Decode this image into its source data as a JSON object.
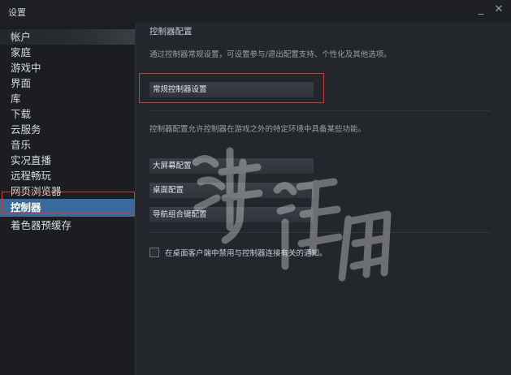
{
  "window": {
    "title": "设置",
    "minimize": "_",
    "close": "✕"
  },
  "sidebar": {
    "items": [
      {
        "label": "帐户"
      },
      {
        "label": "家庭"
      },
      {
        "label": "游戏中"
      },
      {
        "label": "界面"
      },
      {
        "label": "库"
      },
      {
        "label": "下载"
      },
      {
        "label": "云服务"
      },
      {
        "label": "音乐"
      },
      {
        "label": "实况直播"
      },
      {
        "label": "远程畅玩"
      },
      {
        "label": "网页浏览器"
      },
      {
        "label": "控制器"
      },
      {
        "label": "着色器预缓存"
      }
    ],
    "active_index": 11
  },
  "main": {
    "title": "控制器配置",
    "description": "通过控制器常规设置，可设置参与/退出配置支持、个性化及其他选项。",
    "general_button": "常规控制器设置",
    "description2": "控制器配置允许控制器在游戏之外的特定环境中具备某些功能。",
    "config_buttons": [
      "大屏幕配置",
      "桌面配置",
      "导航组合键配置"
    ],
    "checkbox_label": "在桌面客户端中禁用与控制器连接有关的通知。",
    "checkbox_checked": false
  },
  "icons": {
    "minimize": "minimize-icon",
    "close": "close-icon",
    "checkbox": "checkbox-icon"
  },
  "colors": {
    "accent": "#3a6a9b",
    "highlight": "#d23a3a",
    "background": "#23262b"
  }
}
